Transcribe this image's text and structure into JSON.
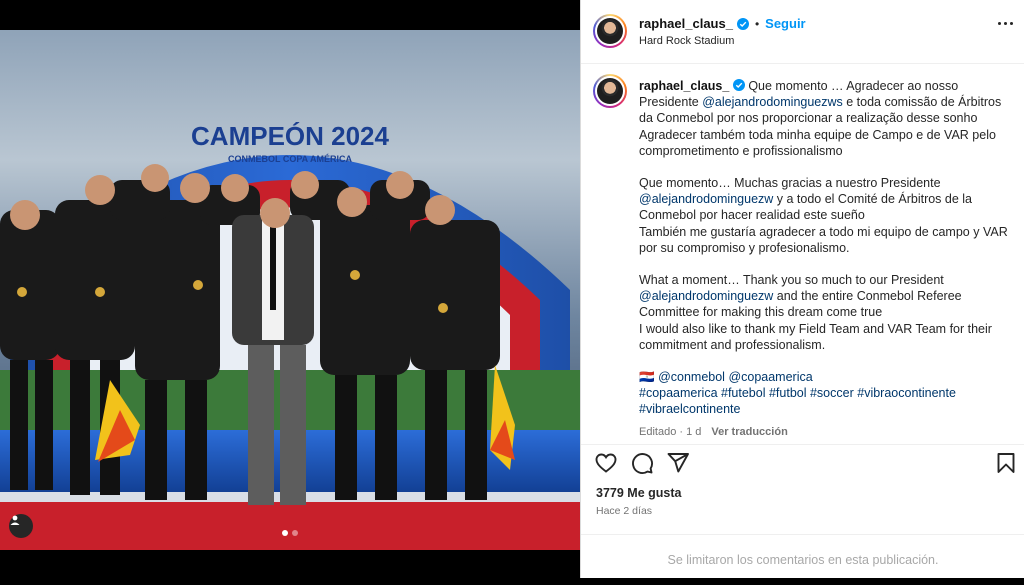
{
  "post": {
    "username": "raphael_claus_",
    "follow_label": "Seguir",
    "separator": "•",
    "location": "Hard Rock Stadium",
    "photo_banner_text": "CAMPEÓN 2024",
    "photo_banner_sub": "CONMEBOL COPA AMÉRICA",
    "carousel_count": 2
  },
  "caption": {
    "username": "raphael_claus_",
    "p1_line1": "Que momento … Agradecer ao nosso",
    "p1_pre_mention": "Presidente ",
    "mention1": "@alejandrodominguezws",
    "p1_post_mention": " e toda comissão de Árbitros da Conmebol por nos proporcionar a realização desse sonho",
    "p1_line4": "Agradecer também toda minha equipe de Campo e de VAR pelo comprometimento e profissionalismo",
    "p2_line1": "Que momento… Muchas gracias a nuestro Presidente",
    "mention2": "@alejandrodominguezw",
    "p2_post_mention": " y a todo el Comité de Árbitros de la Conmebol por hacer realidad este sueño",
    "p2_line4": "También me gustaría agradecer a todo mi equipo de campo y VAR por su compromiso y profesionalismo.",
    "p3_line1": "What a moment… Thank you so much to our President",
    "mention3": "@alejandrodominguezw",
    "p3_post_mention": " and the entire Conmebol Referee Committee for making this dream come true",
    "p3_line4": "I would also like to thank my Field Team and VAR Team for their commitment and professionalism.",
    "flag_emoji": "🇵🇾",
    "tag_mention1": "@conmebol",
    "tag_mention2": "@copaamerica",
    "hashtags_line1": [
      "#copaamerica",
      "#futebol",
      "#futbol",
      "#soccer",
      "#vibraocontinente"
    ],
    "hashtags_line2": [
      "#vibraelcontinente"
    ],
    "edited": "Editado · 1 d",
    "translate": "Ver traducción"
  },
  "stats": {
    "likes": "3779 Me gusta",
    "time": "Hace 2 días",
    "comments_limited": "Se limitaron los comentarios en esta publicación."
  },
  "icons": {
    "like": "heart-icon",
    "comment": "comment-icon",
    "share": "share-icon",
    "save": "bookmark-icon",
    "more": "more-icon",
    "verified": "verified-badge-icon",
    "user_tag": "user-tag-icon"
  },
  "colors": {
    "link": "#00376b",
    "follow": "#0095f6",
    "verified": "#0095f6",
    "muted": "#737373"
  }
}
